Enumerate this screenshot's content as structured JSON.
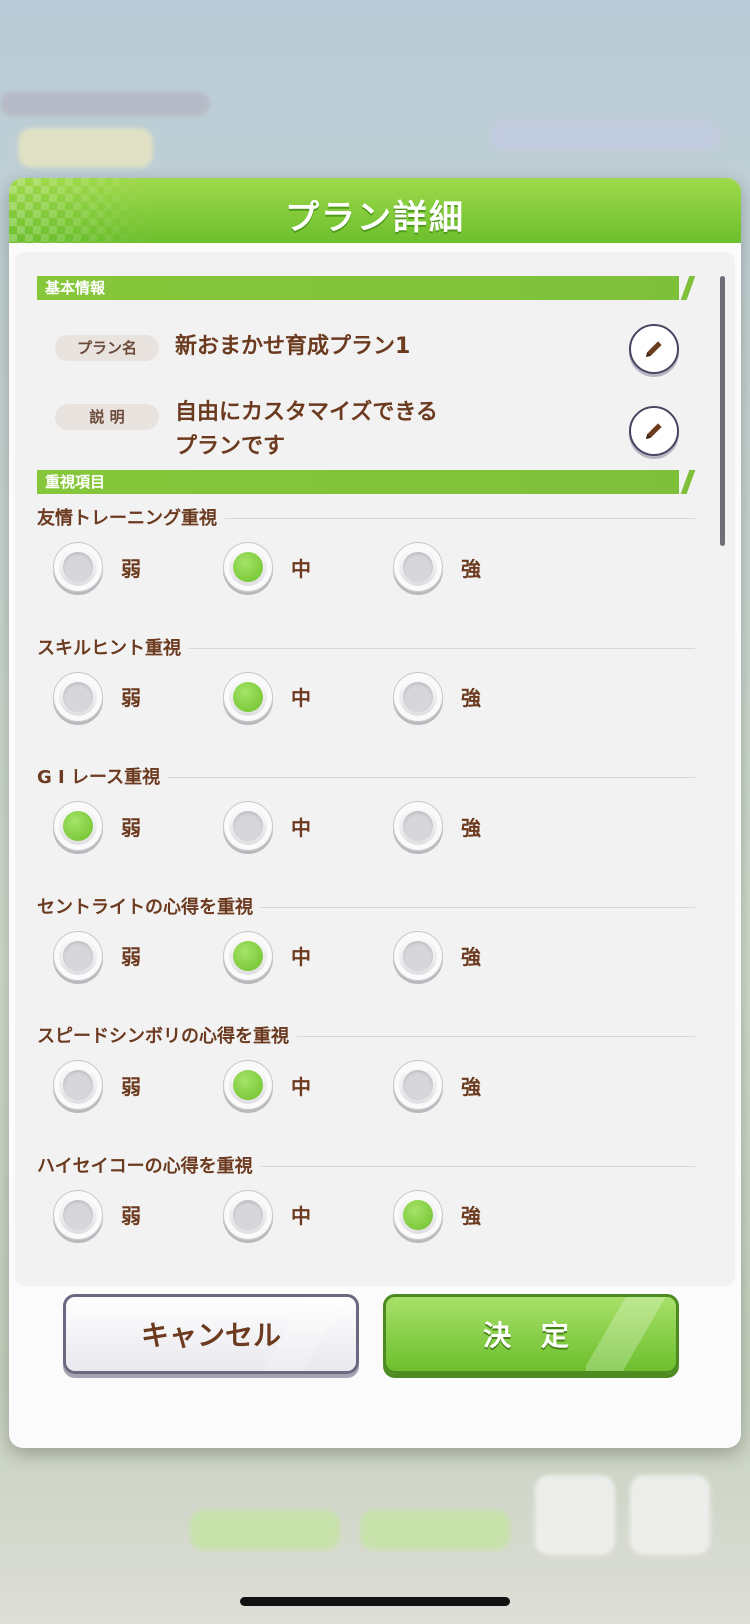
{
  "dialog": {
    "title": "プラン詳細",
    "basic_section": "基本情報",
    "priority_section": "重視項目",
    "name_tag": "プラン名",
    "name_value": "新おまかせ育成プラン1",
    "desc_tag": "説 明",
    "desc_line1": "自由にカスタマイズできる",
    "desc_line2": "プランです"
  },
  "options": [
    "弱",
    "中",
    "強"
  ],
  "groups": [
    {
      "title": "友情トレーニング重視",
      "selected": 1
    },
    {
      "title": "スキルヒント重視",
      "selected": 1
    },
    {
      "title": "G I レース重視",
      "selected": 0
    },
    {
      "title": "セントライトの心得を重視",
      "selected": 1
    },
    {
      "title": "スピードシンボリの心得を重視",
      "selected": 1
    },
    {
      "title": "ハイセイコーの心得を重視",
      "selected": 2
    }
  ],
  "buttons": {
    "cancel": "キャンセル",
    "confirm": "決 定"
  },
  "colors": {
    "accent_green": "#7fc03b",
    "text_brown": "#6b3a1f"
  },
  "icons": {
    "edit": "pencil-icon"
  }
}
